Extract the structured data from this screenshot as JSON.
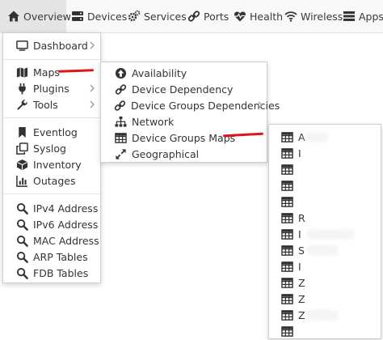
{
  "navbar": {
    "items": [
      {
        "label": "Overview",
        "icon": "home-icon"
      },
      {
        "label": "Devices",
        "icon": "server-icon"
      },
      {
        "label": "Services",
        "icon": "cogs-icon"
      },
      {
        "label": "Ports",
        "icon": "link-icon"
      },
      {
        "label": "Health",
        "icon": "heartbeat-icon"
      },
      {
        "label": "Wireless",
        "icon": "wifi-icon"
      },
      {
        "label": "Apps",
        "icon": "tasks-icon"
      }
    ]
  },
  "overview_menu": {
    "items": [
      {
        "label": "Dashboard",
        "icon": "tv-icon",
        "submenu": true
      },
      {
        "label": "Maps",
        "icon": "map-icon",
        "submenu": true
      },
      {
        "label": "Plugins",
        "icon": "plug-icon",
        "submenu": true
      },
      {
        "label": "Tools",
        "icon": "wrench-icon",
        "submenu": true
      },
      {
        "label": "Eventlog",
        "icon": "bookmark-icon",
        "submenu": false
      },
      {
        "label": "Syslog",
        "icon": "clone-icon",
        "submenu": false
      },
      {
        "label": "Inventory",
        "icon": "cube-icon",
        "submenu": false
      },
      {
        "label": "Outages",
        "icon": "bar-chart-icon",
        "submenu": false
      },
      {
        "label": "IPv4 Address",
        "icon": "search-icon",
        "submenu": false
      },
      {
        "label": "IPv6 Address",
        "icon": "search-icon",
        "submenu": false
      },
      {
        "label": "MAC Address",
        "icon": "search-icon",
        "submenu": false
      },
      {
        "label": "ARP Tables",
        "icon": "search-icon",
        "submenu": false
      },
      {
        "label": "FDB Tables",
        "icon": "search-icon",
        "submenu": false
      }
    ]
  },
  "maps_menu": {
    "items": [
      {
        "label": "Availability",
        "icon": "arrow-circle-up-icon",
        "submenu": false
      },
      {
        "label": "Device Dependency",
        "icon": "chain-icon",
        "submenu": false
      },
      {
        "label": "Device Groups Dependencies",
        "icon": "chain-icon",
        "submenu": true
      },
      {
        "label": "Network",
        "icon": "sitemap-icon",
        "submenu": false
      },
      {
        "label": "Device Groups Maps",
        "icon": "table-icon",
        "submenu": false
      },
      {
        "label": "Geographical",
        "icon": "expand-icon",
        "submenu": false
      }
    ]
  },
  "group_maps_menu": {
    "items": [
      {
        "label": "A"
      },
      {
        "label": "I"
      },
      {
        "label": ""
      },
      {
        "label": ""
      },
      {
        "label": ""
      },
      {
        "label": "R"
      },
      {
        "label": "I"
      },
      {
        "label": "S"
      },
      {
        "label": "I"
      },
      {
        "label": "Z"
      },
      {
        "label": "Z"
      },
      {
        "label": "Z"
      },
      {
        "label": ""
      }
    ]
  },
  "colors": {
    "highlight": "#e0141b",
    "navbar_bg": "#f8f8f8",
    "active_bg": "#e4e4e4"
  }
}
